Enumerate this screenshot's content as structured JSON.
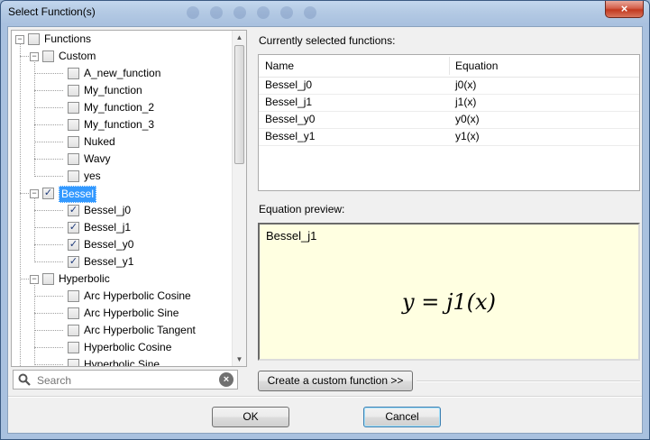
{
  "window": {
    "title": "Select Function(s)",
    "close_label": "×"
  },
  "tree": {
    "root": {
      "label": "Functions",
      "checked": false
    },
    "groups": [
      {
        "label": "Custom",
        "checked": false,
        "selected": false,
        "items": [
          {
            "label": "A_new_function",
            "checked": false
          },
          {
            "label": "My_function",
            "checked": false
          },
          {
            "label": "My_function_2",
            "checked": false
          },
          {
            "label": "My_function_3",
            "checked": false
          },
          {
            "label": "Nuked",
            "checked": false
          },
          {
            "label": "Wavy",
            "checked": false
          },
          {
            "label": "yes",
            "checked": false
          }
        ]
      },
      {
        "label": "Bessel",
        "checked": true,
        "selected": true,
        "items": [
          {
            "label": "Bessel_j0",
            "checked": true
          },
          {
            "label": "Bessel_j1",
            "checked": true
          },
          {
            "label": "Bessel_y0",
            "checked": true
          },
          {
            "label": "Bessel_y1",
            "checked": true
          }
        ]
      },
      {
        "label": "Hyperbolic",
        "checked": false,
        "selected": false,
        "items": [
          {
            "label": "Arc Hyperbolic Cosine",
            "checked": false
          },
          {
            "label": "Arc Hyperbolic Sine",
            "checked": false
          },
          {
            "label": "Arc Hyperbolic Tangent",
            "checked": false
          },
          {
            "label": "Hyperbolic Cosine",
            "checked": false
          },
          {
            "label": "Hyperbolic Sine",
            "checked": false
          }
        ]
      }
    ]
  },
  "search": {
    "placeholder": "Search",
    "value": ""
  },
  "selected_functions": {
    "label": "Currently selected functions:",
    "columns": [
      "Name",
      "Equation"
    ],
    "rows": [
      {
        "name": "Bessel_j0",
        "equation": "j0(x)"
      },
      {
        "name": "Bessel_j1",
        "equation": "j1(x)"
      },
      {
        "name": "Bessel_y0",
        "equation": "y0(x)"
      },
      {
        "name": "Bessel_y1",
        "equation": "y1(x)"
      }
    ]
  },
  "preview": {
    "label": "Equation preview:",
    "function_name": "Bessel_j1",
    "equation": "y = j1(x)"
  },
  "buttons": {
    "custom_function": "Create a custom function >>",
    "ok": "OK",
    "cancel": "Cancel"
  },
  "colors": {
    "selection": "#3399ff",
    "preview_bg": "#ffffe1",
    "close_button": "#c1391f"
  }
}
